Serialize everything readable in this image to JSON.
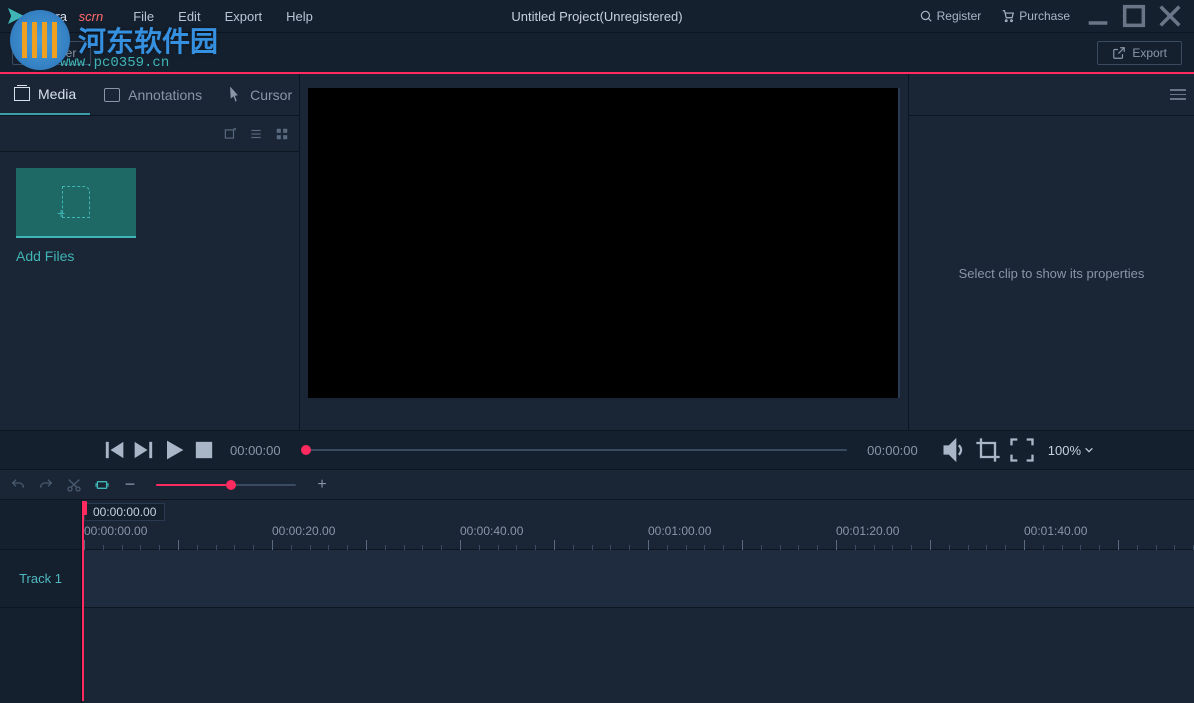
{
  "app": {
    "logo1": "filmora",
    "logo2": "scrn"
  },
  "menu": {
    "file": "File",
    "edit": "Edit",
    "export": "Export",
    "help": "Help"
  },
  "title": "Untitled Project(Unregistered)",
  "titlebar": {
    "register": "Register",
    "purchase": "Purchase"
  },
  "toolbar": {
    "recorder": "Recorder",
    "export": "Export"
  },
  "tabs": {
    "media": "Media",
    "annotations": "Annotations",
    "cursor": "Cursor"
  },
  "media": {
    "add_files": "Add Files"
  },
  "properties_empty": "Select clip to show its properties",
  "playback": {
    "current": "00:00:00",
    "duration": "00:00:00",
    "zoom": "100%"
  },
  "timeline": {
    "playhead": "00:00:00.00",
    "marks": [
      "00:00:00.00",
      "00:00:20.00",
      "00:00:40.00",
      "00:01:00.00",
      "00:01:20.00",
      "00:01:40.00"
    ],
    "track1": "Track 1"
  },
  "watermark": {
    "chars": "河东软件园",
    "url": "www.pc0359.cn"
  }
}
